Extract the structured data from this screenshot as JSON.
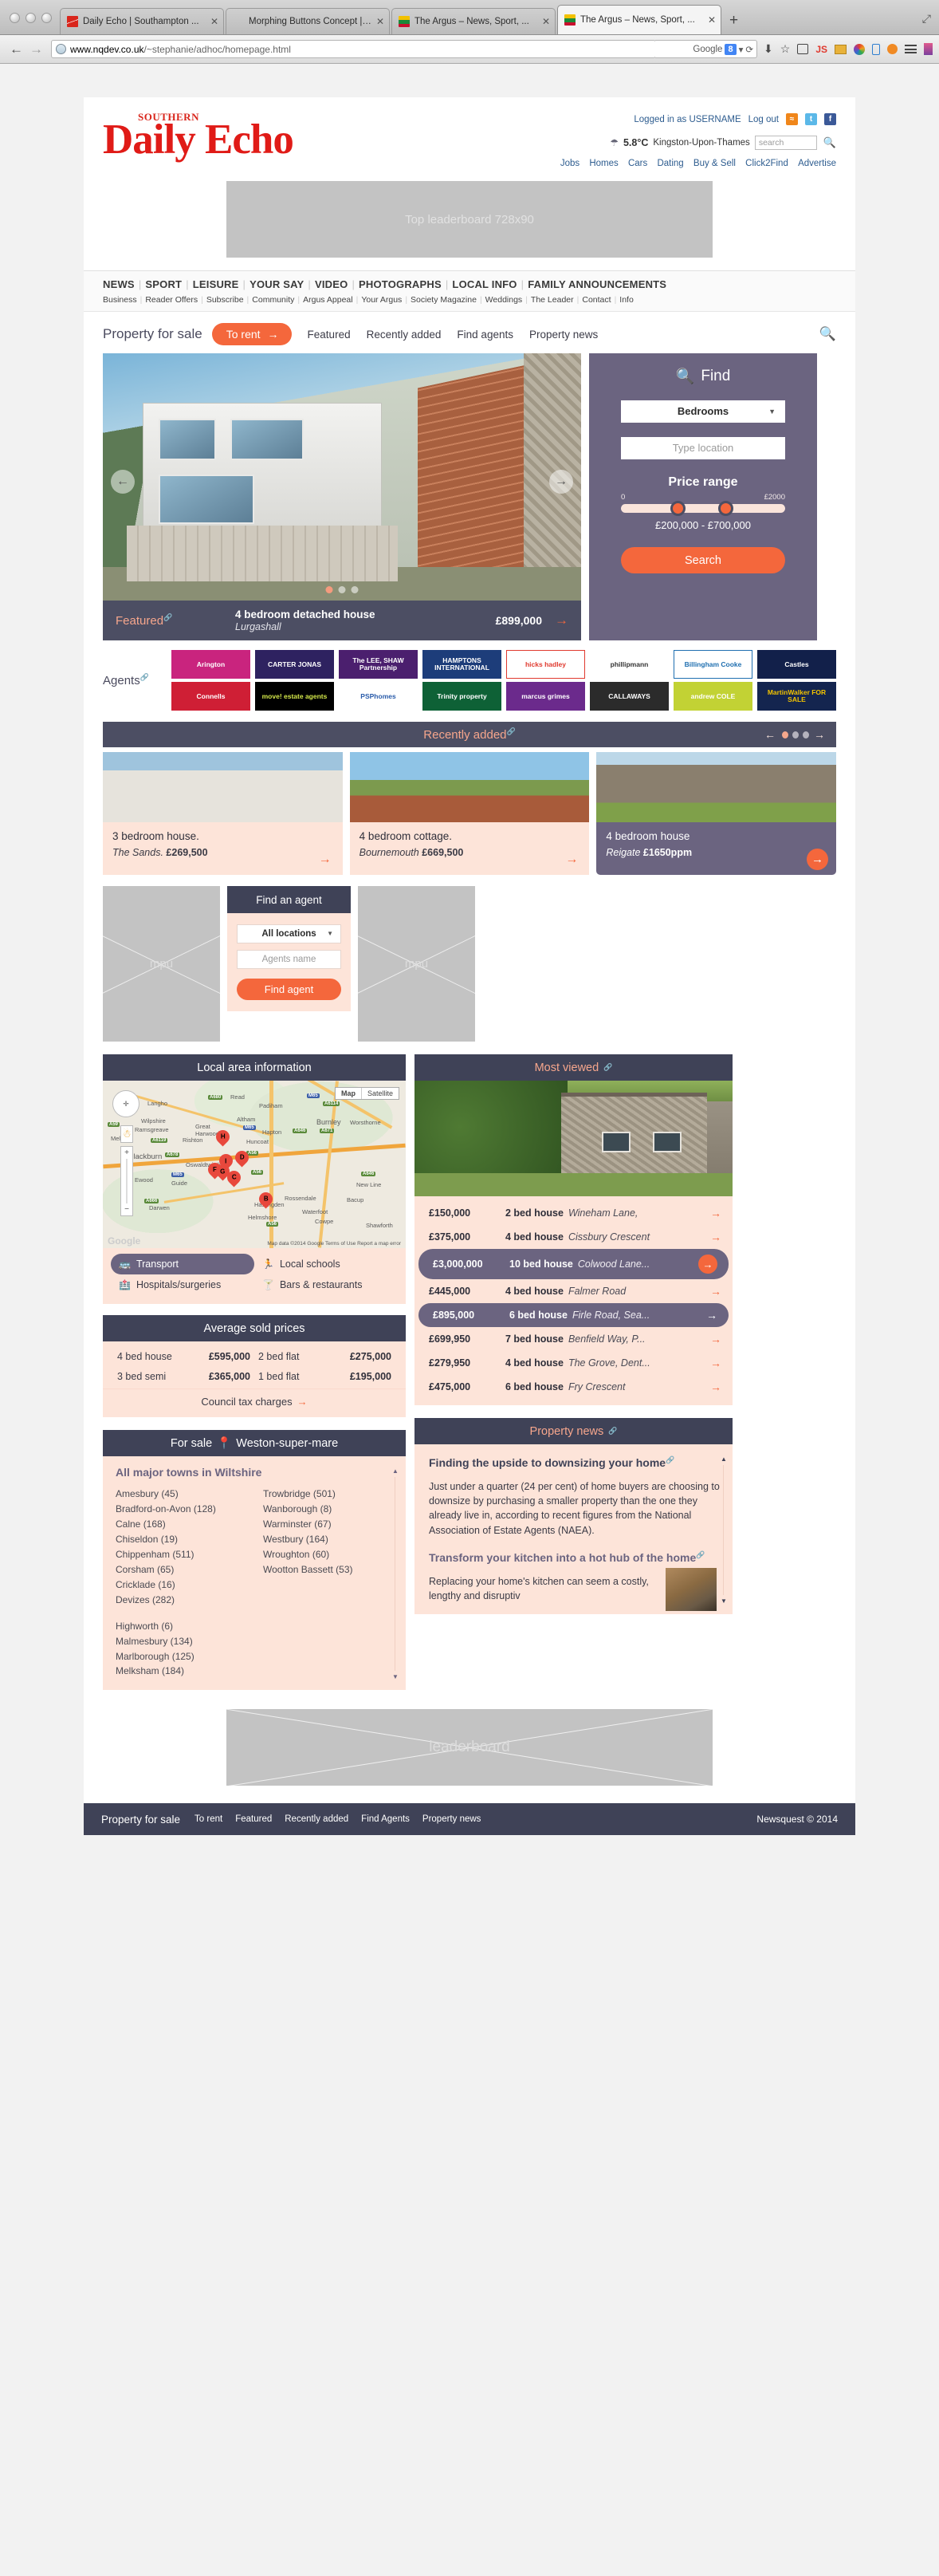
{
  "browser": {
    "tabs": [
      {
        "title": "Daily Echo | Southampton ...",
        "favicon": "echo-favicon",
        "active": false
      },
      {
        "title": "Morphing Buttons Concept | D...",
        "favicon": "blank-favicon",
        "active": false
      },
      {
        "title": "The Argus – News, Sport, ...",
        "favicon": "argus-favicon",
        "active": false
      },
      {
        "title": "The Argus – News, Sport, ...",
        "favicon": "argus-favicon",
        "active": true
      }
    ],
    "new_tab_label": "+",
    "close_label": "✕",
    "back_label": "←",
    "forward_label": "→",
    "url_host": "www.nqdev.co.uk",
    "url_path": "/~stephanie/adhoc/homepage.html",
    "search_engine": "Google",
    "search_badge": "8",
    "reload_label": "⟳",
    "restore_label": "⤢"
  },
  "header": {
    "logo_top": "SOUTHERN",
    "logo_main": "Daily Echo",
    "logged_in": "Logged in as USERNAME",
    "logout": "Log out",
    "social": [
      "rss-icon",
      "twitter-icon",
      "facebook-icon"
    ],
    "weather_temp": "5.8°C",
    "weather_location": "Kingston-Upon-Thames",
    "search_placeholder": "search",
    "quick_links": [
      "Jobs",
      "Homes",
      "Cars",
      "Dating",
      "Buy & Sell",
      "Click2Find",
      "Advertise"
    ]
  },
  "leaderboard_top": {
    "label": "Top leaderboard 728x90"
  },
  "nav": {
    "primary": [
      "NEWS",
      "SPORT",
      "LEISURE",
      "YOUR SAY",
      "VIDEO",
      "PHOTOGRAPHS",
      "LOCAL INFO",
      "FAMILY ANNOUNCEMENTS"
    ],
    "secondary": [
      "Business",
      "Reader Offers",
      "Subscribe",
      "Community",
      "Argus Appeal",
      "Your Argus",
      "Society Magazine",
      "Weddings",
      "The Leader",
      "Contact",
      "Info"
    ]
  },
  "property_tabs": {
    "title": "Property for sale",
    "active_pill": "To rent",
    "items": [
      "Featured",
      "Recently added",
      "Find agents",
      "Property news"
    ]
  },
  "hero": {
    "featured_label": "Featured",
    "title": "4 bedroom detached house",
    "location": "Lurgashall",
    "price": "£899,000",
    "prev_label": "←",
    "next_label": "→",
    "go_label": "→",
    "dots": 3,
    "active_dot": 0
  },
  "find": {
    "title": "Find",
    "bedrooms_value": "Bedrooms",
    "location_placeholder": "Type location",
    "price_range_label": "Price range",
    "slider_min": "0",
    "slider_max": "£2000",
    "price_text": "£200,000 - £700,000",
    "search_button": "Search"
  },
  "agents": {
    "label": "Agents",
    "logos": [
      {
        "name": "Arington",
        "bg": "#c9247e",
        "fg": "#ffffff"
      },
      {
        "name": "CARTER JONAS",
        "bg": "#2e2260",
        "fg": "#ffffff"
      },
      {
        "name": "The LEE, SHAW Partnership",
        "bg": "#4b1f6e",
        "fg": "#ffffff"
      },
      {
        "name": "HAMPTONS INTERNATIONAL",
        "bg": "#1d3d7a",
        "fg": "#ffffff"
      },
      {
        "name": "hicks hadley",
        "bg": "#ffffff",
        "fg": "#e03a2f"
      },
      {
        "name": "phillipmann",
        "bg": "#ffffff",
        "fg": "#333333"
      },
      {
        "name": "Billingham Cooke",
        "bg": "#ffffff",
        "fg": "#1f6fb0"
      },
      {
        "name": "Castles",
        "bg": "#12204a",
        "fg": "#ffffff"
      },
      {
        "name": "Connells",
        "bg": "#cf1f35",
        "fg": "#ffffff"
      },
      {
        "name": "move! estate agents",
        "bg": "#000000",
        "fg": "#d4e84a"
      },
      {
        "name": "PSPhomes",
        "bg": "#ffffff",
        "fg": "#2a5caa"
      },
      {
        "name": "Trinity property",
        "bg": "#0e6136",
        "fg": "#ffffff"
      },
      {
        "name": "marcus grimes",
        "bg": "#6b2a8c",
        "fg": "#ffffff"
      },
      {
        "name": "CALLAWAYS",
        "bg": "#2b2b2b",
        "fg": "#ffffff"
      },
      {
        "name": "andrew COLE",
        "bg": "#c2d234",
        "fg": "#ffffff"
      },
      {
        "name": "MartinWalker FOR SALE",
        "bg": "#14254f",
        "fg": "#f2c300"
      }
    ]
  },
  "recently_added": {
    "heading": "Recently added",
    "prev_label": "←",
    "next_label": "→",
    "dots": 3,
    "active_dot": 0,
    "cards": [
      {
        "title": "3 bedroom house.",
        "location": "The Sands.",
        "price": "£269,500",
        "highlight": false
      },
      {
        "title": "4 bedroom cottage.",
        "location": "Bournemouth",
        "price": "£669,500",
        "highlight": false
      },
      {
        "title": "4 bedroom house",
        "location": "Reigate",
        "price": "£1650ppm",
        "highlight": true
      }
    ]
  },
  "mpu": {
    "label": "mpu"
  },
  "find_agent": {
    "heading": "Find an agent",
    "locations_value": "All locations",
    "name_placeholder": "Agents name",
    "button": "Find agent"
  },
  "local_area": {
    "heading": "Local area information",
    "map": {
      "type_map": "Map",
      "type_satellite": "Satellite",
      "credit": "Google",
      "attribution": "Map data ©2014 Google    Terms of Use    Report a map error",
      "pins": [
        "H",
        "I",
        "F",
        "G",
        "D",
        "C",
        "B"
      ],
      "labels": [
        "Langho",
        "Read",
        "Padiham",
        "Wilpshire",
        "Altham",
        "Burnley",
        "Worsthorne",
        "Ramsgreave",
        "Great Harwood",
        "Hapton",
        "Huncoat",
        "Rishton",
        "Mellor",
        "Blackburn",
        "Oswaldtwistle",
        "Ewood",
        "Guide",
        "Rossendale",
        "Bacup",
        "Haslingden",
        "Darwen",
        "Helmshore",
        "Waterfoot",
        "Cowpe",
        "Shawforth",
        "New Line"
      ],
      "road_shields": [
        "A59",
        "A680",
        "M65",
        "A6114",
        "A671",
        "A646",
        "A6119",
        "A678",
        "A56",
        "A666"
      ]
    },
    "tabs": [
      {
        "label": "Transport",
        "icon": "bus-icon",
        "active": true
      },
      {
        "label": "Local schools",
        "icon": "children-icon",
        "active": false
      },
      {
        "label": "Hospitals/surgeries",
        "icon": "hospital-icon",
        "active": false
      },
      {
        "label": "Bars & restaurants",
        "icon": "bar-icon",
        "active": false
      }
    ]
  },
  "average_prices": {
    "heading": "Average sold prices",
    "rows": [
      {
        "label": "4 bed house",
        "value": "£595,000"
      },
      {
        "label": "2 bed flat",
        "value": "£275,000"
      },
      {
        "label": "3 bed semi",
        "value": "£365,000"
      },
      {
        "label": "1 bed flat",
        "value": "£195,000"
      }
    ],
    "footer_link": "Council tax charges"
  },
  "most_viewed": {
    "heading": "Most viewed",
    "items": [
      {
        "price": "£150,000",
        "beds": "2 bed house",
        "address": "Wineham Lane,",
        "highlight": false
      },
      {
        "price": "£375,000",
        "beds": "4 bed house",
        "address": "Cissbury Crescent",
        "highlight": false
      },
      {
        "price": "£3,000,000",
        "beds": "10 bed house",
        "address": "Colwood Lane...",
        "highlight": true,
        "circle": true
      },
      {
        "price": "£445,000",
        "beds": "4 bed house",
        "address": "Falmer Road",
        "highlight": false
      },
      {
        "price": "£895,000",
        "beds": "6 bed house",
        "address": "Firle Road, Sea...",
        "highlight": true,
        "circle": false
      },
      {
        "price": "£699,950",
        "beds": "7 bed house",
        "address": "Benfield Way, P...",
        "highlight": false
      },
      {
        "price": "£279,950",
        "beds": "4 bed house",
        "address": "The Grove, Dent...",
        "highlight": false
      },
      {
        "price": "£475,000",
        "beds": "6 bed house",
        "address": "Fry Crescent",
        "highlight": false
      }
    ]
  },
  "for_sale": {
    "heading_prefix": "For sale",
    "heading_location": "Weston-super-mare",
    "subtitle": "All major towns in Wiltshire",
    "col_left": [
      {
        "name": "Amesbury (45)",
        "gap": false
      },
      {
        "name": "Bradford-on-Avon (128)",
        "gap": false
      },
      {
        "name": "Calne (168)",
        "gap": false
      },
      {
        "name": "Chiseldon (19)",
        "gap": false
      },
      {
        "name": "Chippenham (511)",
        "gap": false
      },
      {
        "name": "Corsham (65)",
        "gap": false
      },
      {
        "name": "Cricklade (16)",
        "gap": false
      },
      {
        "name": "Devizes (282)",
        "gap": false
      },
      {
        "name": "Highworth (6)",
        "gap": true
      },
      {
        "name": "Malmesbury (134)",
        "gap": false
      },
      {
        "name": "Marlborough (125)",
        "gap": false
      },
      {
        "name": "Melksham (184)",
        "gap": false
      }
    ],
    "col_right": [
      {
        "name": "Trowbridge (501)",
        "gap": false
      },
      {
        "name": "Wanborough (8)",
        "gap": false
      },
      {
        "name": "Warminster (67)",
        "gap": false
      },
      {
        "name": "Westbury (164)",
        "gap": false
      },
      {
        "name": "Wroughton (60)",
        "gap": false
      },
      {
        "name": "Wootton Bassett (53)",
        "gap": false
      }
    ]
  },
  "property_news": {
    "heading": "Property news",
    "article1_title": "Finding the upside to downsizing your home",
    "article1_body": "Just under a quarter (24 per cent) of home buyers are choosing to downsize by purchasing a smaller property than the one they already live in, according to recent figures from the National Association of Estate Agents (NAEA).",
    "article2_title": "Transform your kitchen into a hot hub of the home",
    "article2_body": "Replacing your home's kitchen can seem a costly, lengthy and disruptiv"
  },
  "leaderboard_bottom": {
    "label": "leaderboard"
  },
  "footer": {
    "main": "Property for sale",
    "links": [
      "To rent",
      "Featured",
      "Recently added",
      "Find Agents",
      "Property news"
    ],
    "copyright": "Newsquest © 2014"
  },
  "colors": {
    "accent_orange": "#f4673c",
    "dark_navy": "#3f4257",
    "slate": "#4c4e63",
    "purple": "#6b6480",
    "peach_bg": "#fde4d9",
    "logo_red": "#e01b17"
  }
}
